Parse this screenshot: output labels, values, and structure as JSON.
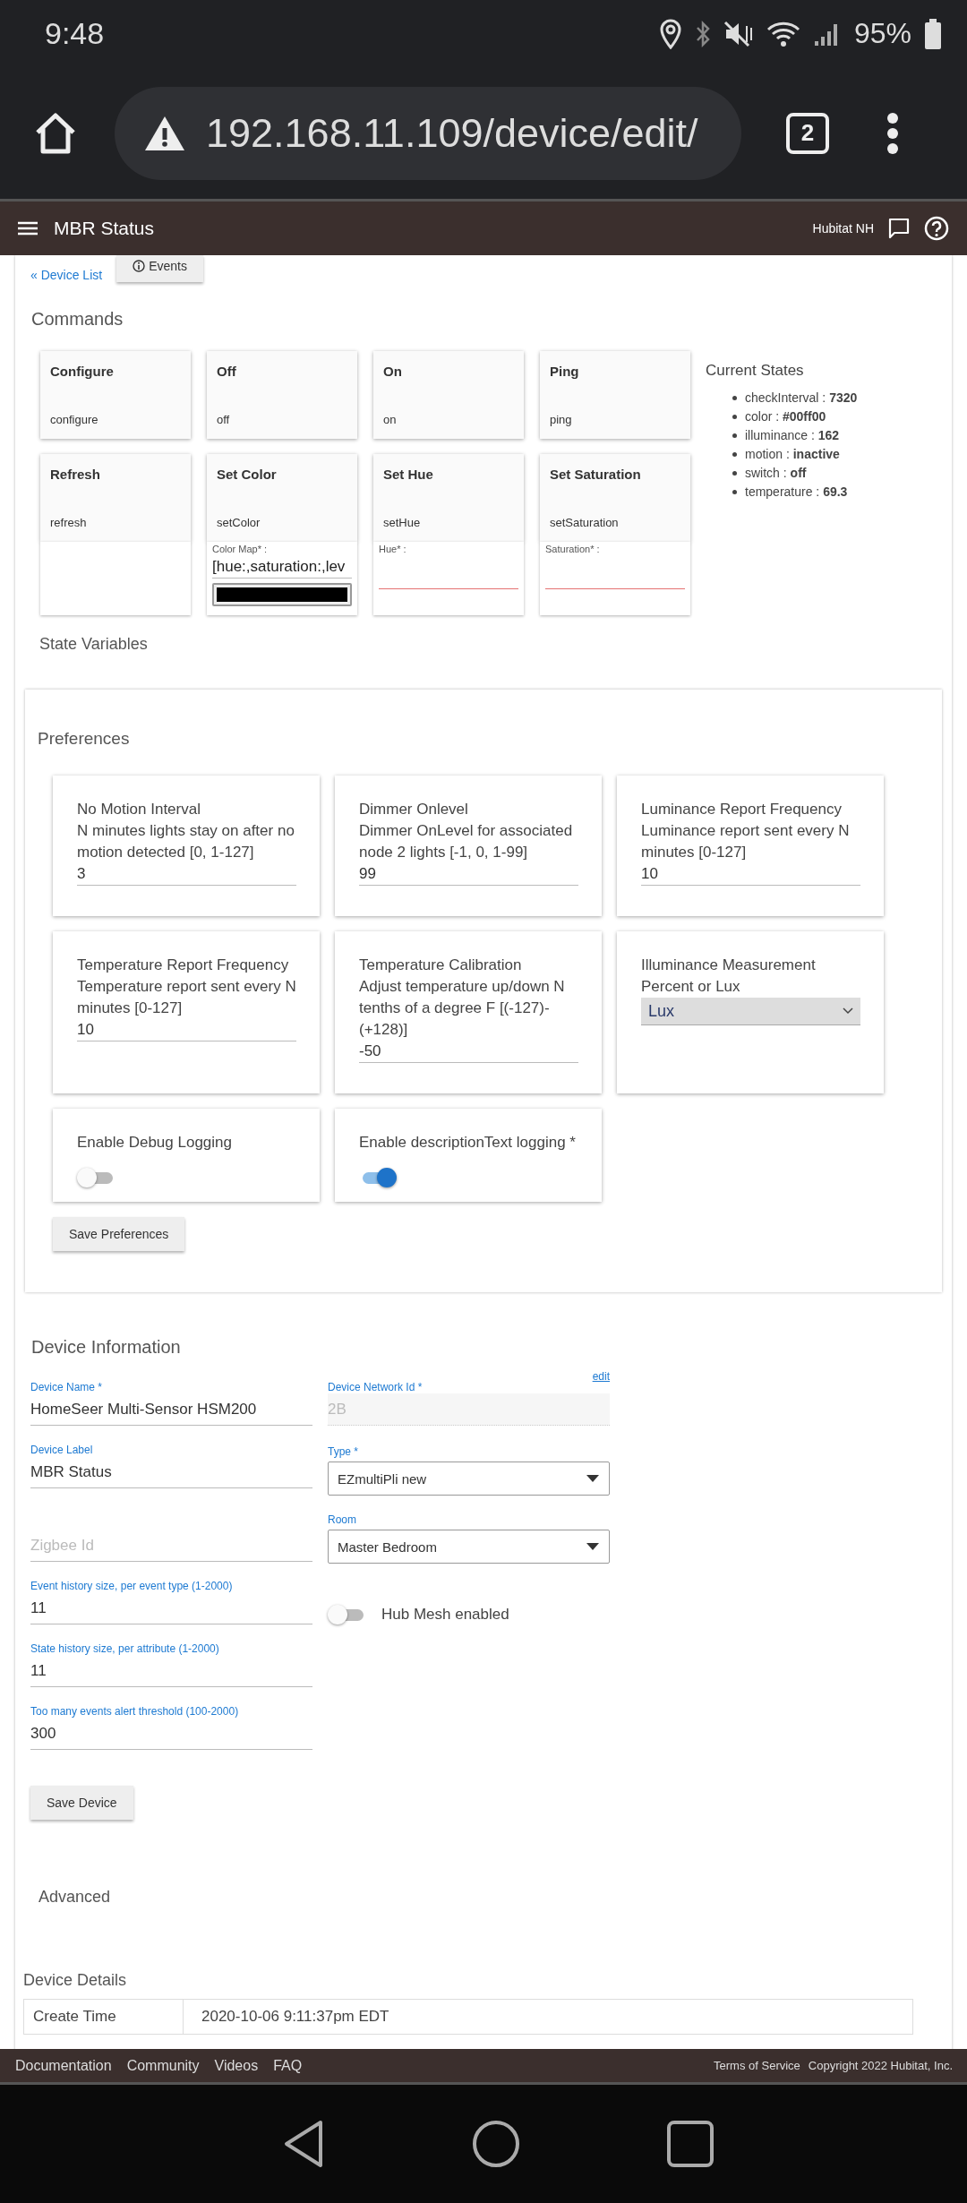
{
  "status_bar": {
    "time": "9:48",
    "battery": "95%"
  },
  "browser": {
    "url": "192.168.11.109/device/edit/",
    "tab_count": "2"
  },
  "app_bar": {
    "title": "MBR Status",
    "hub": "Hubitat NH"
  },
  "nav": {
    "back_link": "« Device List",
    "events_button": "Events"
  },
  "commands": {
    "title": "Commands",
    "tiles": [
      {
        "kind": "plain",
        "name": "Configure",
        "method": "configure"
      },
      {
        "kind": "plain",
        "name": "Off",
        "method": "off"
      },
      {
        "kind": "plain",
        "name": "On",
        "method": "on"
      },
      {
        "kind": "plain",
        "name": "Ping",
        "method": "ping"
      },
      {
        "kind": "parameters",
        "name": "Refresh",
        "method": "refresh"
      },
      {
        "kind": "parameters",
        "name": "Set Color",
        "method": "setColor",
        "inputs": [
          {
            "kind": "text",
            "label": "Color Map* :",
            "value": "[hue:,saturation:,lev"
          },
          {
            "kind": "color"
          }
        ]
      },
      {
        "kind": "parameters",
        "name": "Set Hue",
        "method": "setHue",
        "inputs": [
          {
            "kind": "required",
            "label": "Hue* :"
          }
        ]
      },
      {
        "kind": "parameters",
        "name": "Set Saturation",
        "method": "setSaturation",
        "inputs": [
          {
            "kind": "required",
            "label": "Saturation* :"
          }
        ]
      }
    ]
  },
  "current_states": {
    "title": "Current States",
    "items": [
      "checkInterval : **7320**",
      "color : **#00ff00**",
      "illuminance : **162**",
      "motion : **inactive**",
      "switch : **off**",
      "temperature : **69.3**"
    ]
  },
  "state_variables": {
    "title": "State Variables"
  },
  "preferences": {
    "title": "Preferences",
    "items": [
      {
        "kind": "number",
        "title": "No Motion Interval",
        "description": "N minutes lights stay on after no motion detected [0, 1-127]",
        "value": "3"
      },
      {
        "kind": "number",
        "title": "Dimmer Onlevel",
        "description": "Dimmer OnLevel for associated node 2 lights [-1, 0, 1-99]",
        "value": "99"
      },
      {
        "kind": "number",
        "title": "Luminance Report Frequency",
        "description": "Luminance report sent every N minutes [0-127]",
        "value": "10"
      },
      {
        "kind": "number",
        "title": "Temperature Report Frequency",
        "description": "Temperature report sent every N minutes [0-127]",
        "value": "10"
      },
      {
        "kind": "number",
        "title": "Temperature Calibration",
        "description": "Adjust temperature up/down N tenths of a degree F [(-127)-(+128)]",
        "value": "-50"
      },
      {
        "kind": "select",
        "title": "Illuminance Measurement",
        "description": "Percent or Lux",
        "value": "Lux"
      },
      {
        "kind": "toggle",
        "title": "Enable Debug Logging",
        "checked": false
      },
      {
        "kind": "toggle",
        "title": "Enable descriptionText logging *",
        "checked": true
      }
    ],
    "save_button": "Save Preferences"
  },
  "device_information": {
    "title": "Device Information",
    "left_fields": [
      {
        "label": "Device Name *",
        "value": "HomeSeer Multi-Sensor HSM200"
      },
      {
        "label": "Device Label",
        "value": "MBR Status"
      },
      {
        "placeholder": "Zigbee Id"
      },
      {
        "label": "Event history size, per event type (1-2000)",
        "value": "11"
      },
      {
        "label": "State history size, per attribute (1-2000)",
        "value": "11"
      },
      {
        "label": "Too many events alert threshold (100-2000)",
        "value": "300"
      }
    ],
    "network_id": {
      "label": "Device Network Id *",
      "value": "2B",
      "edit_link": "edit",
      "disabled": true
    },
    "type": {
      "label": "Type *",
      "value": "EZmultiPli new"
    },
    "room": {
      "label": "Room",
      "value": "Master Bedroom"
    },
    "hub_mesh": {
      "label": "Hub Mesh enabled",
      "checked": false
    },
    "save_button": "Save Device"
  },
  "advanced": {
    "title": "Advanced"
  },
  "device_details": {
    "title": "Device Details",
    "rows": [
      {
        "label": "Create Time",
        "value": "2020-10-06 9:11:37pm EDT"
      }
    ]
  },
  "footer": {
    "links": [
      "Documentation",
      "Community",
      "Videos",
      "FAQ"
    ],
    "terms": "Terms of Service",
    "copyright": "Copyright 2022 Hubitat, Inc."
  }
}
